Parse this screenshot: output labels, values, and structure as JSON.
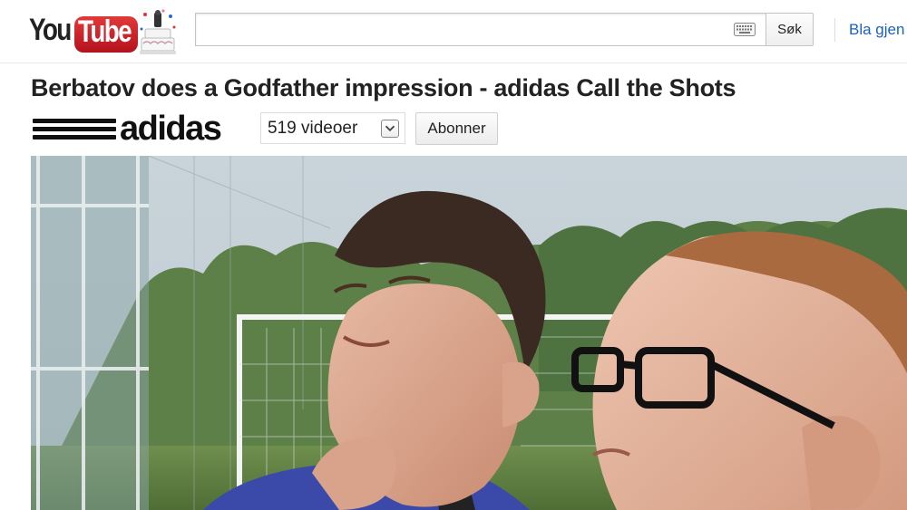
{
  "header": {
    "logo": {
      "word_you": "You",
      "word_tube": "Tube",
      "icon": "cake-icon"
    },
    "search": {
      "value": "",
      "placeholder": "",
      "button_label": "Søk",
      "keyboard_icon": "keyboard-icon"
    },
    "browse_label": "Bla gjen"
  },
  "video": {
    "title": "Berbatov does a Godfather impression - adidas Call the Shots",
    "channel": {
      "brand": "adidas",
      "video_count_label": "519 videoer",
      "subscribe_label": "Abonner",
      "dropdown_icon": "chevron-down-icon"
    },
    "player": {
      "scene": "two-men-football-pitch"
    }
  },
  "colors": {
    "link": "#1c62b9",
    "tube_red": "#cc1f26",
    "title": "#222222"
  }
}
